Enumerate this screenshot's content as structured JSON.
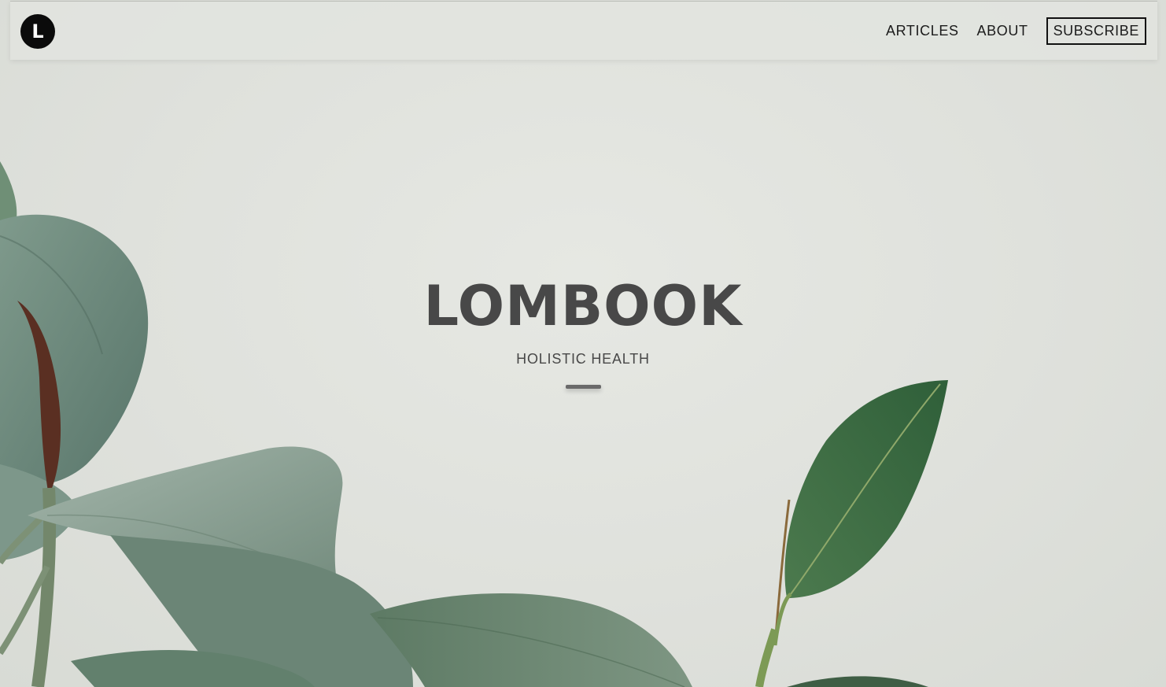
{
  "logo": {
    "letter": "L"
  },
  "nav": {
    "articles_label": "ARTICLES",
    "about_label": "ABOUT",
    "subscribe_label": "SUBSCRIBE"
  },
  "hero": {
    "title": "LOMBOOK",
    "subtitle": "HOLISTIC HEALTH"
  },
  "colors": {
    "background": "#dfe1dc",
    "text": "#484848",
    "leaf_dark": "#3f6e47",
    "leaf_pale": "#8ea496"
  }
}
